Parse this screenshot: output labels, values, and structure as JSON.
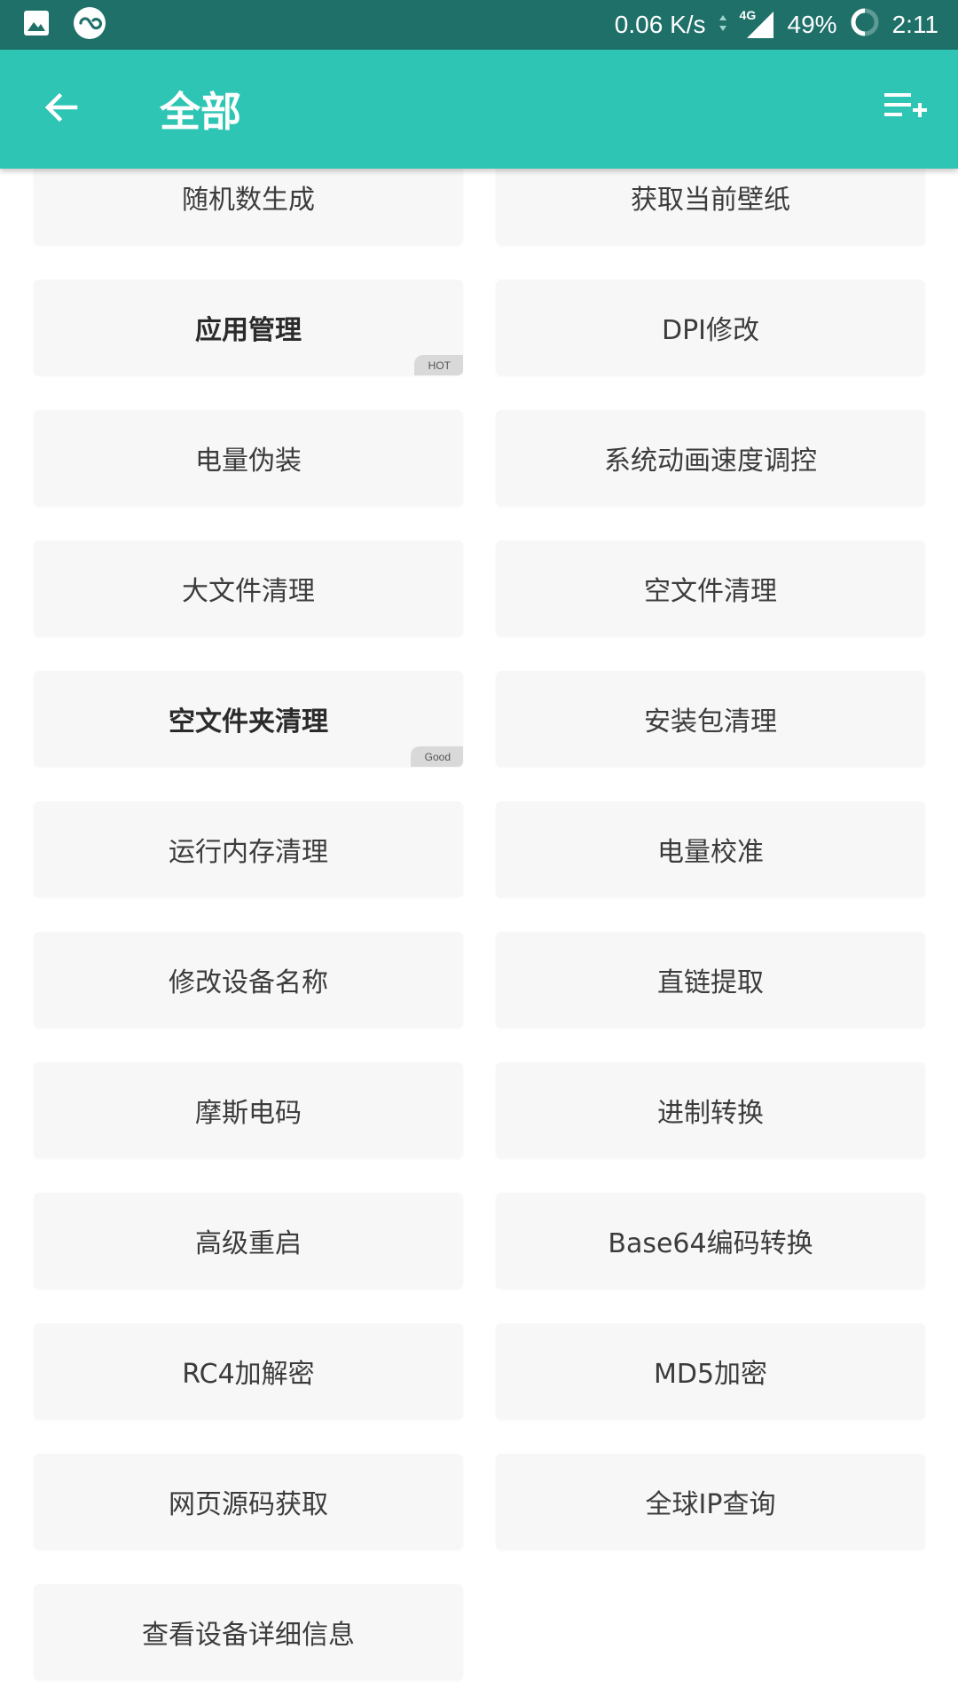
{
  "status_bar": {
    "speed": "0.06 K/s",
    "network": "4G",
    "battery": "49%",
    "time": "2:11",
    "icons": [
      "image-icon",
      "app-logo-icon",
      "data-arrows-icon",
      "signal-icon",
      "battery-ring-icon"
    ]
  },
  "toolbar": {
    "title": "全部",
    "back_icon": "arrow-left-icon",
    "add_icon": "playlist-add-icon",
    "color": "#2fc5b4"
  },
  "tools": [
    {
      "label": "随机数生成",
      "bold": false,
      "badge": ""
    },
    {
      "label": "获取当前壁纸",
      "bold": false,
      "badge": ""
    },
    {
      "label": "应用管理",
      "bold": true,
      "badge": "HOT"
    },
    {
      "label": "DPI修改",
      "bold": false,
      "badge": ""
    },
    {
      "label": "电量伪装",
      "bold": false,
      "badge": ""
    },
    {
      "label": "系统动画速度调控",
      "bold": false,
      "badge": ""
    },
    {
      "label": "大文件清理",
      "bold": false,
      "badge": ""
    },
    {
      "label": "空文件清理",
      "bold": false,
      "badge": ""
    },
    {
      "label": "空文件夹清理",
      "bold": true,
      "badge": "Good"
    },
    {
      "label": "安装包清理",
      "bold": false,
      "badge": ""
    },
    {
      "label": "运行内存清理",
      "bold": false,
      "badge": ""
    },
    {
      "label": "电量校准",
      "bold": false,
      "badge": ""
    },
    {
      "label": "修改设备名称",
      "bold": false,
      "badge": ""
    },
    {
      "label": "直链提取",
      "bold": false,
      "badge": ""
    },
    {
      "label": "摩斯电码",
      "bold": false,
      "badge": ""
    },
    {
      "label": "进制转换",
      "bold": false,
      "badge": ""
    },
    {
      "label": "高级重启",
      "bold": false,
      "badge": ""
    },
    {
      "label": "Base64编码转换",
      "bold": false,
      "badge": ""
    },
    {
      "label": "RC4加解密",
      "bold": false,
      "badge": ""
    },
    {
      "label": "MD5加密",
      "bold": false,
      "badge": ""
    },
    {
      "label": "网页源码获取",
      "bold": false,
      "badge": ""
    },
    {
      "label": "全球IP查询",
      "bold": false,
      "badge": ""
    },
    {
      "label": "查看设备详细信息",
      "bold": false,
      "badge": ""
    }
  ]
}
